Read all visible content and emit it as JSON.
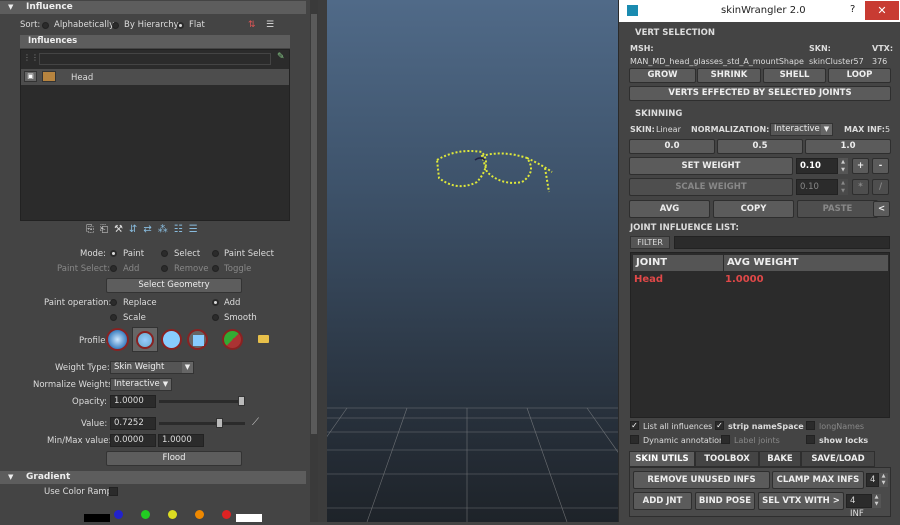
{
  "influence": {
    "title": "Influence",
    "sort_label": "Sort:",
    "sort_options": [
      "Alphabetically",
      "By Hierarchy",
      "Flat"
    ],
    "influences_header": "Influences",
    "items": [
      "Head"
    ]
  },
  "paint": {
    "mode_label": "Mode:",
    "mode_options": [
      "Paint",
      "Select",
      "Paint Select"
    ],
    "paint_select_label": "Paint Select:",
    "paint_select_options": [
      "Add",
      "Remove",
      "Toggle"
    ],
    "select_geometry": "Select Geometry",
    "operation_label": "Paint operation:",
    "operations": [
      "Replace",
      "Add",
      "Scale",
      "Smooth"
    ],
    "profile_label": "Profile:",
    "weight_type_label": "Weight Type:",
    "weight_type": "Skin Weight",
    "normalize_label": "Normalize Weights:",
    "normalize": "Interactive",
    "opacity_label": "Opacity:",
    "opacity": "1.0000",
    "opacity_level": 1.0,
    "value_label": "Value:",
    "value": "0.7252",
    "value_level": 0.7252,
    "minmax_label": "Min/Max value:",
    "min": "0.0000",
    "max": "1.0000",
    "flood": "Flood"
  },
  "gradient": {
    "title": "Gradient",
    "use_color_ramp": "Use Color Ramp"
  },
  "sw": {
    "title": "skinWrangler 2.0",
    "help": "?",
    "vert_selection": "VERT SELECTION",
    "msh_label": "MSH:",
    "skn_label": "SKN:",
    "vtx_label": "VTX:",
    "msh": "MAN_MD_head_glasses_std_A_mountShape",
    "skn": "skinCluster57",
    "vtx": "376",
    "grow": "GROW",
    "shrink": "SHRINK",
    "shell": "SHELL",
    "loop": "LOOP",
    "verts_effected": "VERTS EFFECTED BY SELECTED JOINTS",
    "skinning": "SKINNING",
    "skin_label": "SKIN:",
    "skin": "Linear",
    "normalization_label": "NORMALIZATION:",
    "normalization": "Interactive",
    "max_inf_label": "MAX INF:",
    "max_inf": "5",
    "preset_0": "0.0",
    "preset_5": "0.5",
    "preset_1": "1.0",
    "set_weight": "SET WEIGHT",
    "set_weight_val": "0.10",
    "plus": "+",
    "minus": "-",
    "scale_weight": "SCALE WEIGHT",
    "scale_weight_val": "0.10",
    "mult": "*",
    "div": "/",
    "avg": "AVG",
    "copy": "COPY",
    "paste": "PASTE",
    "arrow": "<",
    "joint_list_title": "JOINT INFLUENCE LIST:",
    "filter": "FILTER",
    "col_joint": "JOINT",
    "col_avg": "AVG WEIGHT",
    "rows": [
      {
        "joint": "Head",
        "weight": "1.0000"
      }
    ],
    "list_all": "List all influences",
    "strip_ns": "strip nameSpace",
    "long_names": "longNames",
    "dyn_annot": "Dynamic annotation",
    "label_joints": "Label joints",
    "show_locks": "show locks",
    "tabs": [
      "SKIN UTILS",
      "TOOLBOX",
      "BAKE",
      "SAVE/LOAD"
    ],
    "remove_unused": "REMOVE UNUSED INFS",
    "clamp_max": "CLAMP MAX INFS",
    "clamp_val": "4",
    "add_jnt": "ADD JNT",
    "bind_pose": "BIND POSE",
    "sel_vtx": "SEL VTX WITH >",
    "inf_val": "4 INF"
  }
}
